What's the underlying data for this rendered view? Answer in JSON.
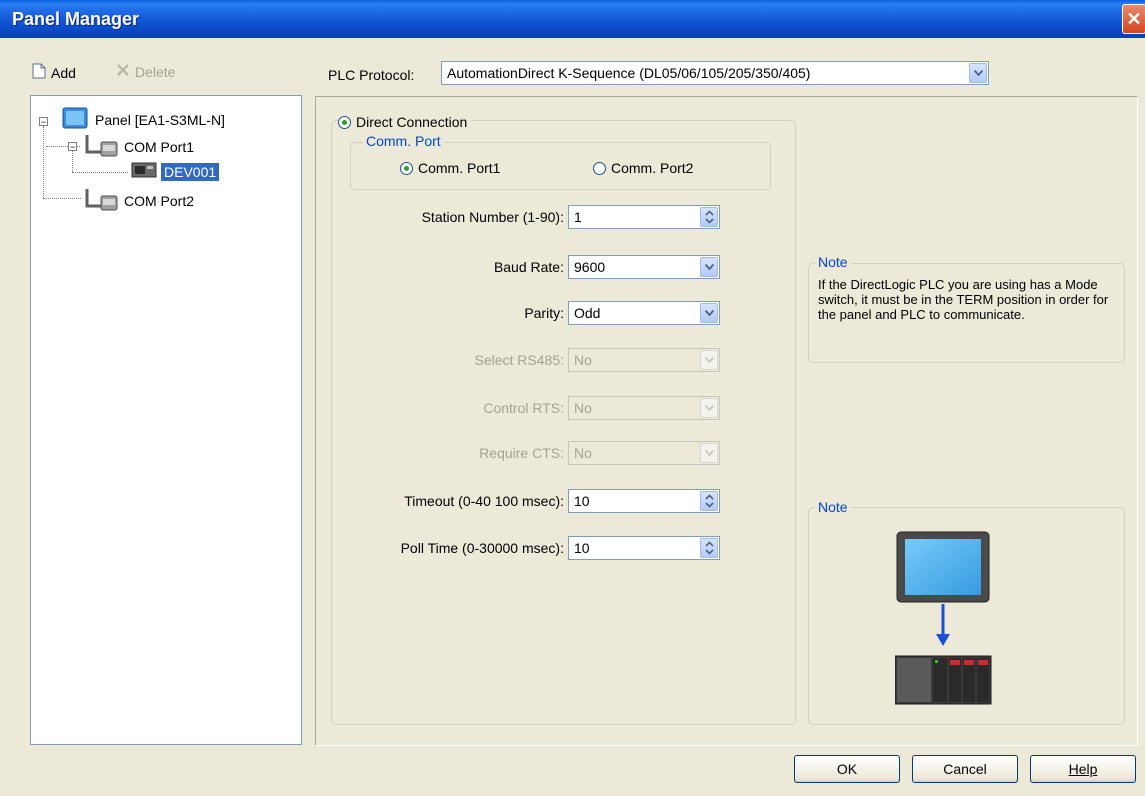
{
  "window": {
    "title": "Panel Manager",
    "close_glyph": "✕"
  },
  "toolbar": {
    "add_label": "Add",
    "delete_label": "Delete"
  },
  "tree": {
    "panel": "Panel [EA1-S3ML-N]",
    "port1": "COM Port1",
    "device": "DEV001",
    "port2": "COM Port2"
  },
  "protocol": {
    "label": "PLC Protocol:",
    "value": "AutomationDirect K-Sequence (DL05/06/105/205/350/405)"
  },
  "connection": {
    "direct_label": "Direct Connection",
    "direct_selected": true,
    "comm_port_group": "Comm. Port",
    "port1_label": "Comm. Port1",
    "port2_label": "Comm. Port2",
    "selected_port": "Comm. Port1"
  },
  "fields": {
    "station_label": "Station Number (1-90):",
    "station_value": "1",
    "baud_label": "Baud Rate:",
    "baud_value": "9600",
    "parity_label": "Parity:",
    "parity_value": "Odd",
    "rs485_label": "Select RS485:",
    "rs485_value": "No",
    "rts_label": "Control RTS:",
    "rts_value": "No",
    "cts_label": "Require CTS:",
    "cts_value": "No",
    "timeout_label": "Timeout (0-40 100 msec):",
    "timeout_value": "10",
    "poll_label": "Poll Time (0-30000 msec):",
    "poll_value": "10"
  },
  "note1": {
    "title": "Note",
    "text": "If the DirectLogic PLC you are using has a Mode switch, it must be in the TERM position in order for the panel and PLC to communicate."
  },
  "note2": {
    "title": "Note"
  },
  "buttons": {
    "ok": "OK",
    "cancel": "Cancel",
    "help": "Help"
  },
  "colors": {
    "titlebar": "#0a47c4",
    "selection": "#316ac5",
    "groupbox_title": "#0046d5"
  }
}
